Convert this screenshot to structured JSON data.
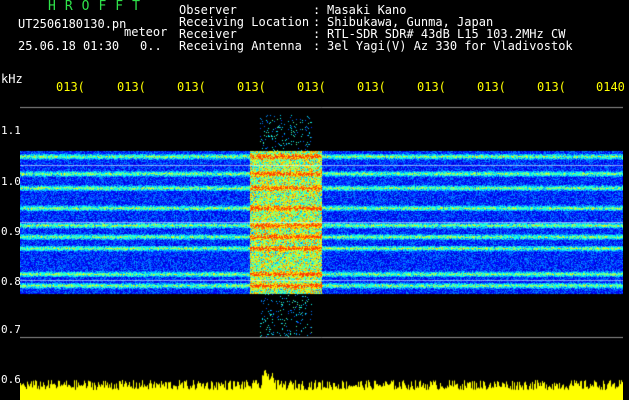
{
  "header": {
    "app_title": "HROFFT",
    "filename": "UT2506180130.pn",
    "detect_label": "meteor",
    "timestamp": "25.06.18 01:30",
    "count": "0..",
    "meta": [
      {
        "label": "Observer",
        "value": "Masaki Kano"
      },
      {
        "label": "Receiving Location",
        "value": "Shibukawa, Gunma, Japan"
      },
      {
        "label": "Receiver",
        "value": "RTL-SDR SDR# 43dB L15 103.2MHz CW"
      },
      {
        "label": "Receiving Antenna",
        "value": "3el Yagi(V) Az 330 for Vladivostok"
      }
    ]
  },
  "axis": {
    "unit": "kHz",
    "time_ticks": [
      "013(",
      "013(",
      "013(",
      "013(",
      "013(",
      "013(",
      "013(",
      "013(",
      "013(",
      "0140"
    ],
    "freq_ticks": [
      "1.1",
      "1.0",
      "0.9",
      "0.8",
      "0.7",
      "0.6"
    ]
  },
  "spectrogram": {
    "freq_range_khz": [
      0.59,
      1.12
    ],
    "bands_khz": [
      1.015,
      0.985,
      0.96,
      0.925,
      0.895,
      0.875,
      0.855,
      0.81,
      0.79
    ],
    "burst_time_fraction": [
      0.38,
      0.5
    ],
    "colors": {
      "background": "#000000",
      "grid": "#ffffff",
      "tick_text": "#ffff00",
      "baseline": "#ffff00",
      "title": "#2fe24a"
    }
  }
}
